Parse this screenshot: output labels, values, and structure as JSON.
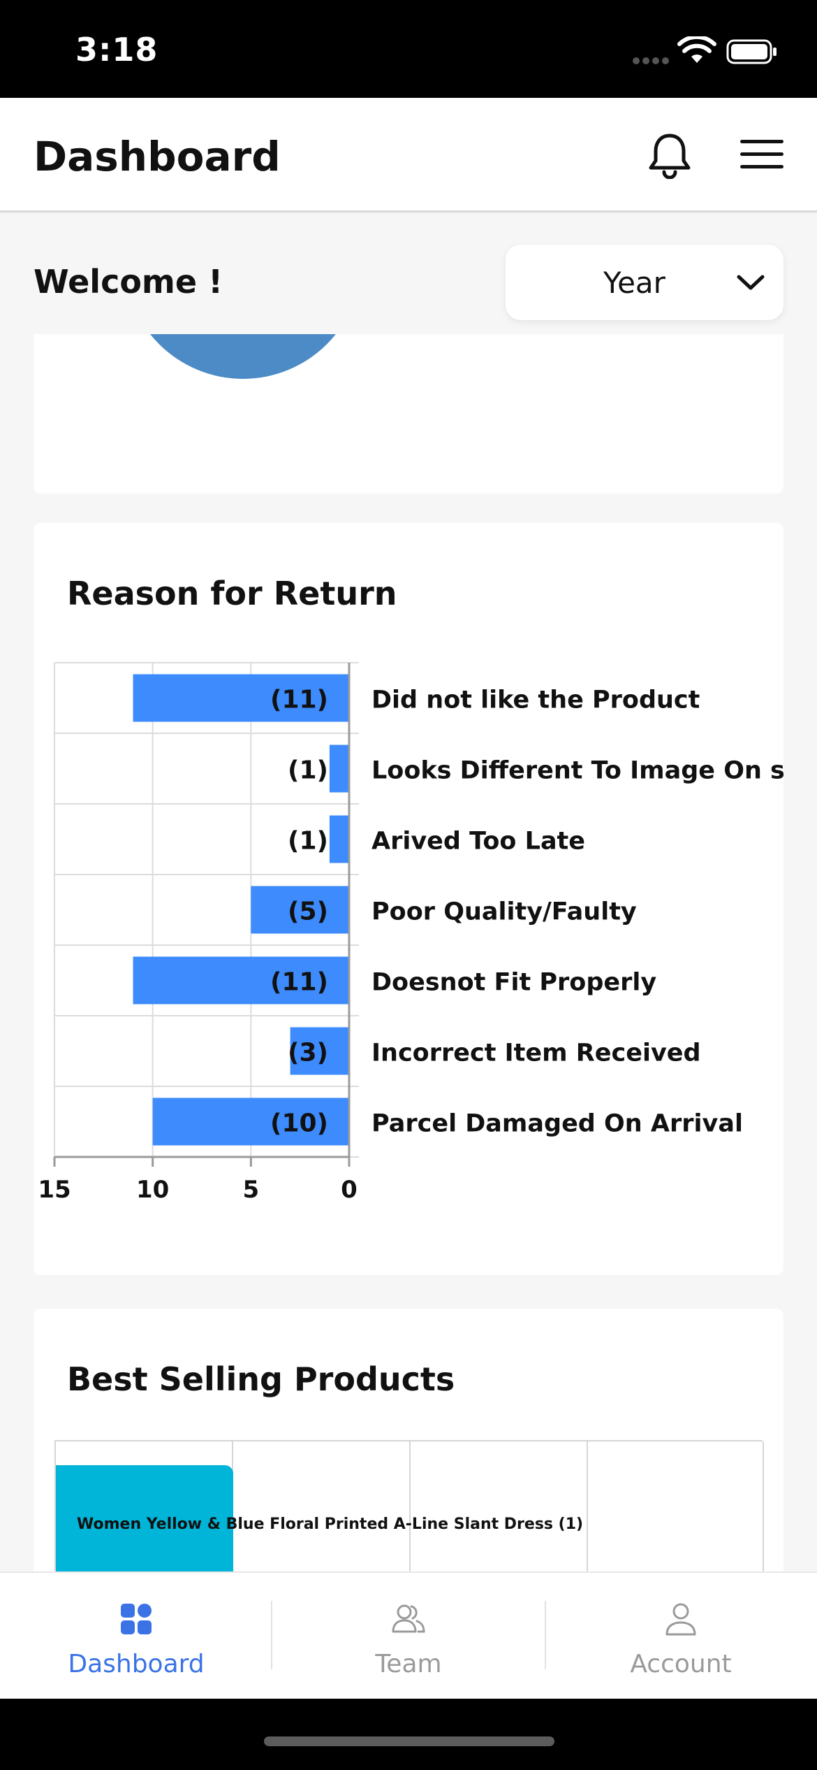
{
  "status_bar": {
    "time": "3:18"
  },
  "header": {
    "title": "Dashboard"
  },
  "welcome": "Welcome !",
  "period_select": {
    "value": "Year"
  },
  "return_reasons": {
    "title": "Reason for Return",
    "chart_data": {
      "type": "bar",
      "orientation": "horizontal",
      "direction": "right-to-left",
      "categories": [
        "Did not like the Product",
        "Looks Different To Image On site",
        "Arived Too Late",
        "Poor Quality/Faulty",
        "Doesnot Fit Properly",
        "Incorrect Item Received",
        "Parcel Damaged On Arrival"
      ],
      "values": [
        11,
        1,
        1,
        5,
        11,
        3,
        10
      ],
      "data_labels": [
        "(11)",
        "(1)",
        "(1)",
        "(5)",
        "(11)",
        "(3)",
        "(10)"
      ],
      "xlim": [
        0,
        15
      ],
      "ticks": [
        "15",
        "10",
        "5",
        "0"
      ],
      "grid": true,
      "bar_color": "#3d8bfd"
    }
  },
  "best_selling": {
    "title": "Best Selling Products",
    "chart_data": {
      "type": "bar",
      "categories": [
        "Women Yellow  & Blue Floral Printed A-Line Slant Dress"
      ],
      "values": [
        1
      ],
      "data_labels": [
        "(1)"
      ],
      "bar_color": "#00b5d8"
    },
    "row_label": "Women Yellow  & Blue Floral Printed A-Line Slant Dress   (1)"
  },
  "tabs": [
    {
      "label": "Dashboard",
      "icon": "grid-icon",
      "active": true
    },
    {
      "label": "Team",
      "icon": "team-icon",
      "active": false
    },
    {
      "label": "Account",
      "icon": "person-icon",
      "active": false
    }
  ],
  "colors": {
    "accent": "#3b73e6",
    "bar": "#3d8bfd",
    "best_bar": "#00b5d8",
    "pie": "#4c8bc6"
  }
}
